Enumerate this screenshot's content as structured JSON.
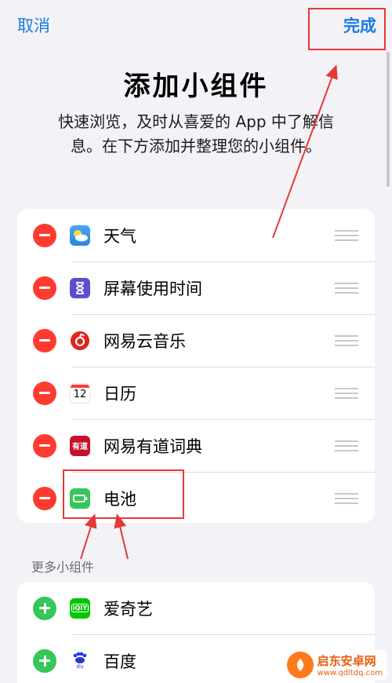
{
  "nav": {
    "cancel_label": "取消",
    "done_label": "完成"
  },
  "header": {
    "title": "添加小组件",
    "subtitle_line1": "快速浏览，及时从喜爱的 App 中了解信",
    "subtitle_line2": "息。在下方添加并整理您的小组件。"
  },
  "widgets": [
    {
      "label": "天气",
      "icon": "weather-icon"
    },
    {
      "label": "屏幕使用时间",
      "icon": "screen-time-icon"
    },
    {
      "label": "网易云音乐",
      "icon": "netease-music-icon"
    },
    {
      "label": "日历",
      "icon": "calendar-icon",
      "icon_text": "12"
    },
    {
      "label": "网易有道词典",
      "icon": "youdao-dictionary-icon",
      "icon_text": "有道"
    },
    {
      "label": "电池",
      "icon": "battery-icon"
    }
  ],
  "more": {
    "section_label": "更多小组件",
    "items": [
      {
        "label": "爱奇艺",
        "icon": "iqiyi-icon",
        "icon_text": "iQIY"
      },
      {
        "label": "百度",
        "icon": "baidu-icon",
        "icon_text": "du"
      }
    ]
  },
  "watermark": {
    "name": "启东安卓网",
    "url": "www.qdltdq.com"
  },
  "colors": {
    "accent": "#1a7ae0",
    "remove": "#ff3b30",
    "add": "#34c759",
    "annotation": "#e53935"
  }
}
